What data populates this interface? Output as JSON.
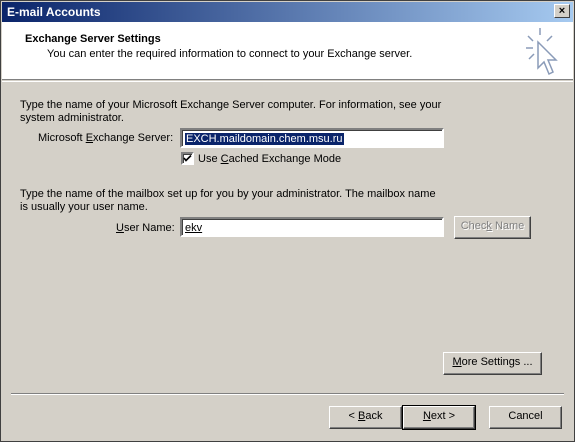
{
  "window": {
    "title": "E-mail Accounts",
    "close_glyph": "×"
  },
  "header": {
    "title": "Exchange Server Settings",
    "subtitle": "You can enter the required information to connect to your Exchange server."
  },
  "server_section": {
    "description_line1": "Type the name of your Microsoft Exchange Server computer. For information, see your",
    "description_line2": "system administrator.",
    "label_pre": "Microsoft ",
    "label_accel": "E",
    "label_post": "xchange Server:",
    "value": "EXCH.maildomain.chem.msu.ru",
    "cached_mode_checked": true,
    "cached_label_pre": "Use ",
    "cached_label_accel": "C",
    "cached_label_post": "ached Exchange Mode"
  },
  "mailbox_section": {
    "description_line1": "Type the name of the mailbox set up for you by your administrator. The mailbox name",
    "description_line2": "is usually your user name.",
    "label_accel": "U",
    "label_post": "ser Name:",
    "value": "ekv",
    "check_name_pre": "Chec",
    "check_name_accel": "k",
    "check_name_post": " Name"
  },
  "buttons": {
    "more_settings_accel": "M",
    "more_settings_post": "ore Settings ...",
    "back_pre": "< ",
    "back_accel": "B",
    "back_post": "ack",
    "next_accel": "N",
    "next_post": "ext >",
    "cancel": "Cancel"
  },
  "icons": {
    "wizard": "wizard-sparkle-cursor-icon",
    "close": "close-icon",
    "check": "checkmark-icon"
  }
}
